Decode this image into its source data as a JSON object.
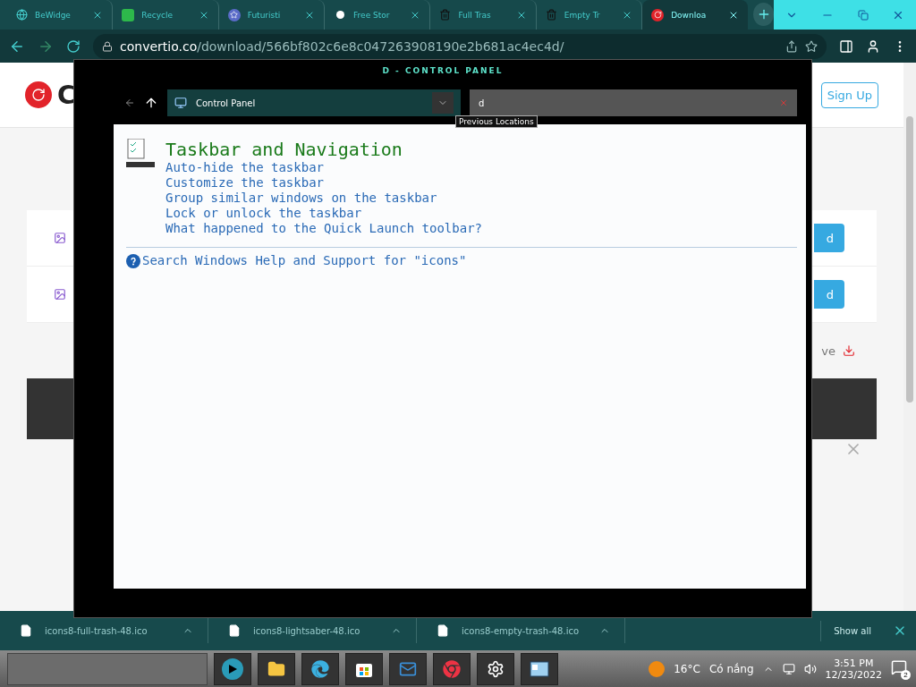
{
  "browser": {
    "tabs": [
      {
        "title": "BeWidge",
        "kind": "globe",
        "selected": false
      },
      {
        "title": "Recycle",
        "kind": "green",
        "selected": false
      },
      {
        "title": "Futuristi",
        "kind": "star",
        "selected": false
      },
      {
        "title": "Free Stor",
        "kind": "dot",
        "selected": false
      },
      {
        "title": "Full Tras",
        "kind": "trash",
        "selected": false
      },
      {
        "title": "Empty Tr",
        "kind": "trash",
        "selected": false
      },
      {
        "title": "Downloa",
        "kind": "convertio",
        "selected": true
      }
    ],
    "address": {
      "host": "convertio.co",
      "path": "/download/566bf802c6e8c047263908190e2b681ac4ec4d/"
    }
  },
  "page": {
    "logo_letter": "C",
    "sign_up": "Sign Up",
    "button_fragments": [
      "d",
      "d"
    ],
    "save_fragment": "ve"
  },
  "control_panel": {
    "title": "D - CONTROL PANEL",
    "breadcrumb": "Control Panel",
    "search_value": "d",
    "tooltip": "Previous Locations",
    "heading": "Taskbar and Navigation",
    "links": [
      "Auto-hide the taskbar",
      "Customize the taskbar",
      "Group similar windows on the taskbar",
      "Lock or unlock the taskbar",
      "What happened to the Quick Launch toolbar?"
    ],
    "help": "Search Windows Help and Support for \"icons\""
  },
  "downloads": {
    "files": [
      "icons8-full-trash-48.ico",
      "icons8-lightsaber-48.ico",
      "icons8-empty-trash-48.ico"
    ],
    "show_all": "Show all"
  },
  "taskbar": {
    "apps": [
      {
        "kind": "media"
      },
      {
        "kind": "folder"
      },
      {
        "kind": "edge"
      },
      {
        "kind": "store"
      },
      {
        "kind": "mail"
      },
      {
        "kind": "chrome"
      },
      {
        "kind": "settings"
      },
      {
        "kind": "panel"
      }
    ],
    "temperature": "16°C",
    "weather": "Có nắng",
    "time": "3:51 PM",
    "date": "12/23/2022",
    "notifications": "2"
  }
}
